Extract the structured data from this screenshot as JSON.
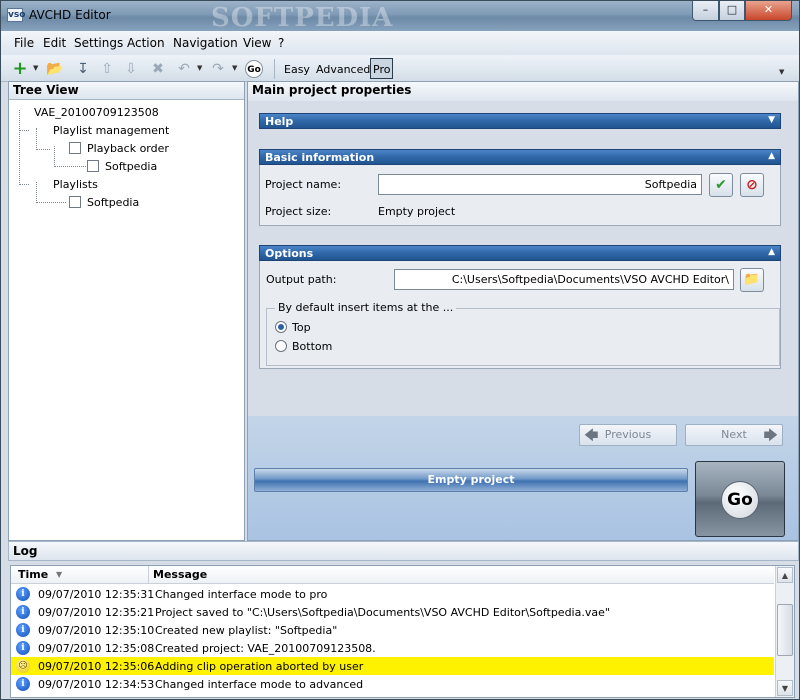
{
  "window": {
    "title": "AVCHD Editor",
    "icon_text": "vso",
    "watermark": "SOFTPEDIA"
  },
  "menu": {
    "items": [
      "File",
      "Edit",
      "Settings",
      "Action",
      "Navigation",
      "View",
      "?"
    ]
  },
  "toolbar": {
    "modes": {
      "easy": "Easy",
      "advanced": "Advanced",
      "pro": "Pro"
    },
    "selected_mode": "Pro",
    "go_label": "Go"
  },
  "tree": {
    "title": "Tree View",
    "root": "VAE_20100709123508",
    "playlist_management": "Playlist management",
    "playback_order": "Playback order",
    "playback_child": "Softpedia",
    "playlists": "Playlists",
    "playlists_child": "Softpedia"
  },
  "main": {
    "title": "Main project properties",
    "help_section": "Help",
    "basic_section": "Basic information",
    "project_name_label": "Project name:",
    "project_name_value": "Softpedia",
    "project_size_label": "Project size:",
    "project_size_value": "Empty project",
    "options_section": "Options",
    "output_path_label": "Output path:",
    "output_path_value": "C:\\Users\\Softpedia\\Documents\\VSO AVCHD Editor\\",
    "insert_group_label": "By default insert items at the ...",
    "radio_top": "Top",
    "radio_bottom": "Bottom",
    "selected_insert": "Top",
    "previous_label": "Previous",
    "next_label": "Next",
    "status_text": "Empty project",
    "go_label": "Go"
  },
  "log": {
    "title": "Log",
    "columns": {
      "time": "Time",
      "message": "Message"
    },
    "rows": [
      {
        "time": "09/07/2010 12:35:31",
        "message": "Changed interface mode to pro",
        "level": "info"
      },
      {
        "time": "09/07/2010 12:35:21",
        "message": "Project saved to \"C:\\Users\\Softpedia\\Documents\\VSO AVCHD Editor\\Softpedia.vae\"",
        "level": "info"
      },
      {
        "time": "09/07/2010 12:35:10",
        "message": "Created new playlist: \"Softpedia\"",
        "level": "info"
      },
      {
        "time": "09/07/2010 12:35:08",
        "message": "Created project: VAE_20100709123508.",
        "level": "info"
      },
      {
        "time": "09/07/2010 12:35:06",
        "message": "Adding clip operation aborted by user",
        "level": "warning"
      },
      {
        "time": "09/07/2010 12:34:53",
        "message": "Changed interface mode to advanced",
        "level": "info"
      }
    ]
  },
  "colors": {
    "section_header": "#2f67a8",
    "warning_row": "#fff200",
    "accept_green": "#2a9a2a",
    "cancel_red": "#c81e1e"
  }
}
